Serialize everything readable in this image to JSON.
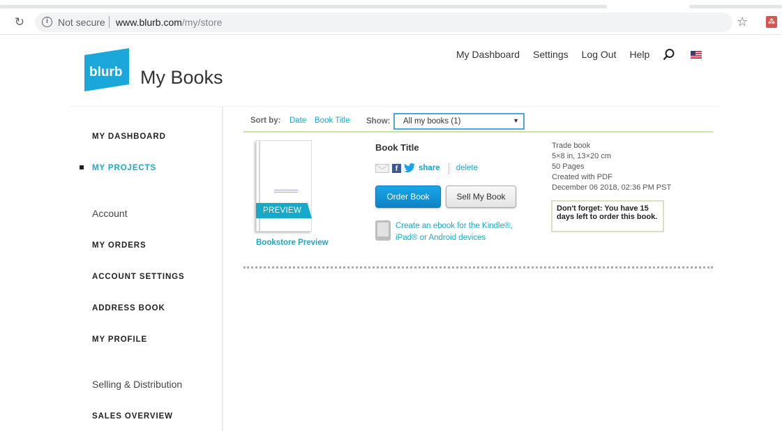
{
  "browser": {
    "security_label": "Not secure",
    "url_host": "www.blurb.com",
    "url_path": "/my/store"
  },
  "header": {
    "logo_text": "blurb",
    "page_title": "My Books",
    "nav": [
      "My Dashboard",
      "Settings",
      "Log Out",
      "Help"
    ]
  },
  "sidebar": {
    "items": {
      "dashboard": "MY DASHBOARD",
      "projects": "MY PROJECTS",
      "account_head": "Account",
      "orders": "MY ORDERS",
      "account_settings": "ACCOUNT SETTINGS",
      "address_book": "ADDRESS BOOK",
      "profile": "MY PROFILE",
      "selling_head": "Selling & Distribution",
      "sales_overview": "SALES OVERVIEW"
    }
  },
  "sortbar": {
    "sort_label": "Sort by:",
    "sort_date": "Date",
    "sort_title": "Book Title",
    "show_label": "Show:",
    "show_value": "All my books (1)"
  },
  "book": {
    "preview_badge": "PREVIEW",
    "bookstore_preview": "Bookstore Preview",
    "title": "Book Title",
    "share_label": "share",
    "delete_label": "delete",
    "order_button": "Order Book",
    "sell_button": "Sell My Book",
    "ebook_line1": "Create an ebook for the Kindle®,",
    "ebook_line2": "iPad® or Android devices",
    "meta": {
      "format": "Trade book",
      "size": "5×8 in, 13×20 cm",
      "pages": "50 Pages",
      "created": "Created with PDF",
      "date": "December 06 2018, 02:36 PM PST"
    },
    "reminder": "Don't forget: You have 15 days left to order this book."
  },
  "colors": {
    "brand": "#1ba7d9",
    "link": "#17a9c9",
    "order_button": "#0c84c8"
  }
}
